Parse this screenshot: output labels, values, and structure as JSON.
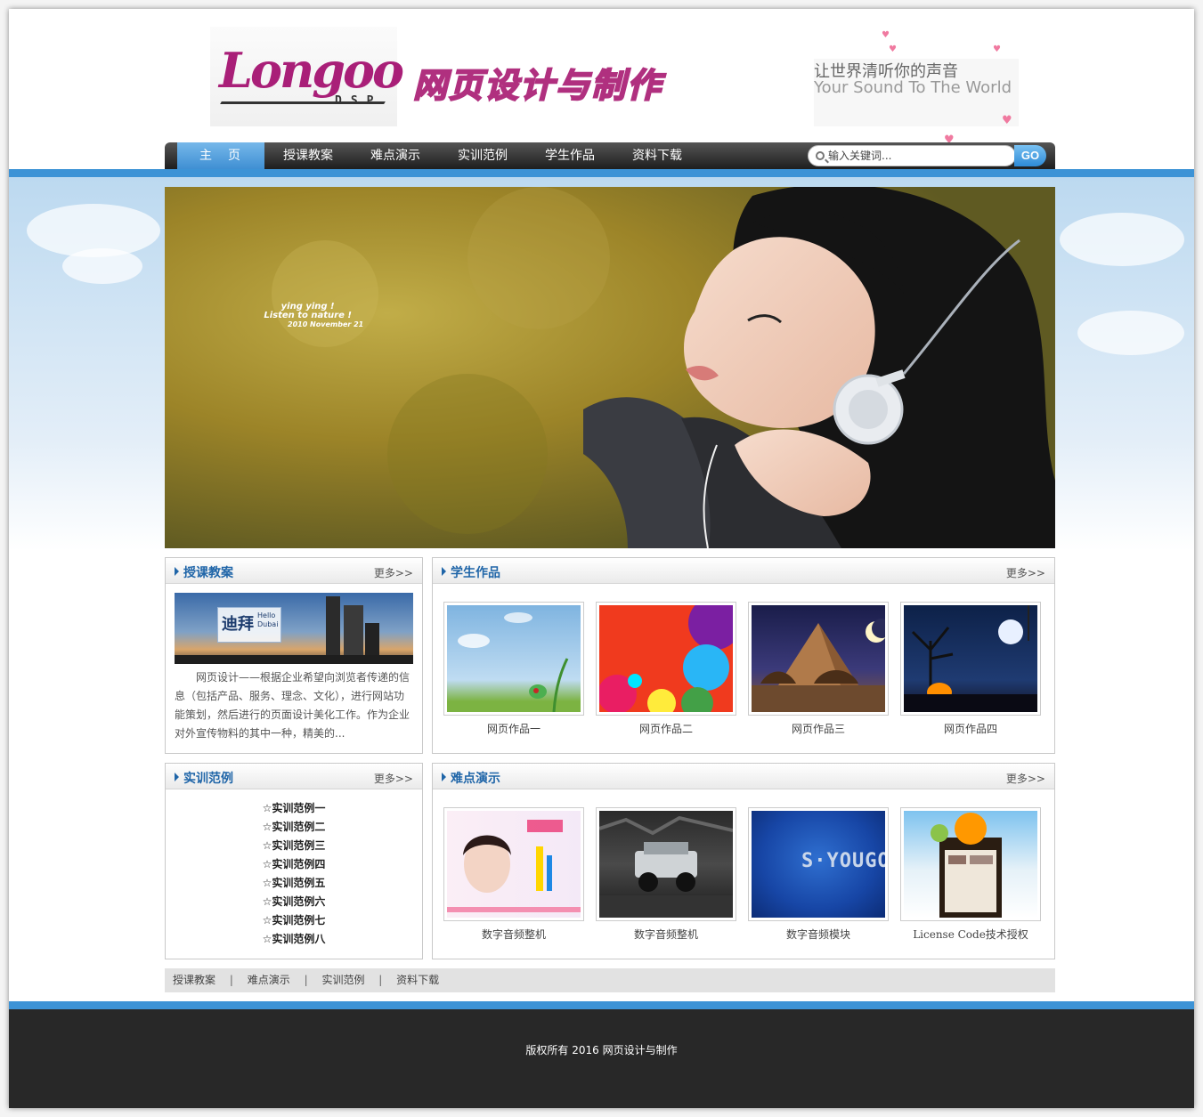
{
  "header": {
    "logo_text": "Longoo",
    "logo_sub": "DSP",
    "site_title": "网页设计与制作",
    "slogan_cn": "让世界清听你的声音",
    "slogan_en": "Your Sound To The World"
  },
  "nav": {
    "items": [
      {
        "label": "主页"
      },
      {
        "label": "授课教案"
      },
      {
        "label": "难点演示"
      },
      {
        "label": "实训范例"
      },
      {
        "label": "学生作品"
      },
      {
        "label": "资料下载"
      }
    ],
    "search_placeholder": "输入关键词...",
    "go_label": "GO"
  },
  "banner": {
    "caption_line1": "ying ying !",
    "caption_line2": "Listen to nature !",
    "caption_line3": "2010 November 21"
  },
  "panels": {
    "lessons": {
      "title": "授课教案",
      "more": "更多>>",
      "image_text_cn": "迪拜",
      "image_text_en1": "Hello",
      "image_text_en2": "Dubai",
      "intro": "网页设计——根据企业希望向浏览者传递的信息（包括产品、服务、理念、文化），进行网站功能策划，然后进行的页面设计美化工作。作为企业对外宣传物料的其中一种，精美的..."
    },
    "works": {
      "title": "学生作品",
      "more": "更多>>",
      "items": [
        {
          "label": "网页作品一"
        },
        {
          "label": "网页作品二"
        },
        {
          "label": "网页作品三"
        },
        {
          "label": "网页作品四"
        }
      ]
    },
    "examples": {
      "title": "实训范例",
      "more": "更多>>",
      "items": [
        {
          "label": "☆实训范例一"
        },
        {
          "label": "☆实训范例二"
        },
        {
          "label": "☆实训范例三"
        },
        {
          "label": "☆实训范例四"
        },
        {
          "label": "☆实训范例五"
        },
        {
          "label": "☆实训范例六"
        },
        {
          "label": "☆实训范例七"
        },
        {
          "label": "☆实训范例八"
        }
      ]
    },
    "demos": {
      "title": "难点演示",
      "more": "更多>>",
      "thumb3_text": "S·YOUGO",
      "items": [
        {
          "label": "数字音频整机"
        },
        {
          "label": "数字音频整机"
        },
        {
          "label": "数字音频模块"
        },
        {
          "label": "License Code技术授权"
        }
      ]
    }
  },
  "footer_links": {
    "items": [
      {
        "label": "授课教案"
      },
      {
        "label": "难点演示"
      },
      {
        "label": "实训范例"
      },
      {
        "label": "资料下载"
      }
    ],
    "separator": "|"
  },
  "footer": {
    "copyright": "版权所有 2016 网页设计与制作"
  },
  "colors": {
    "accent_blue": "#3d93d6",
    "title_blue": "#1f65a8",
    "brand_magenta": "#a91f78",
    "footer_dark": "#282828"
  }
}
